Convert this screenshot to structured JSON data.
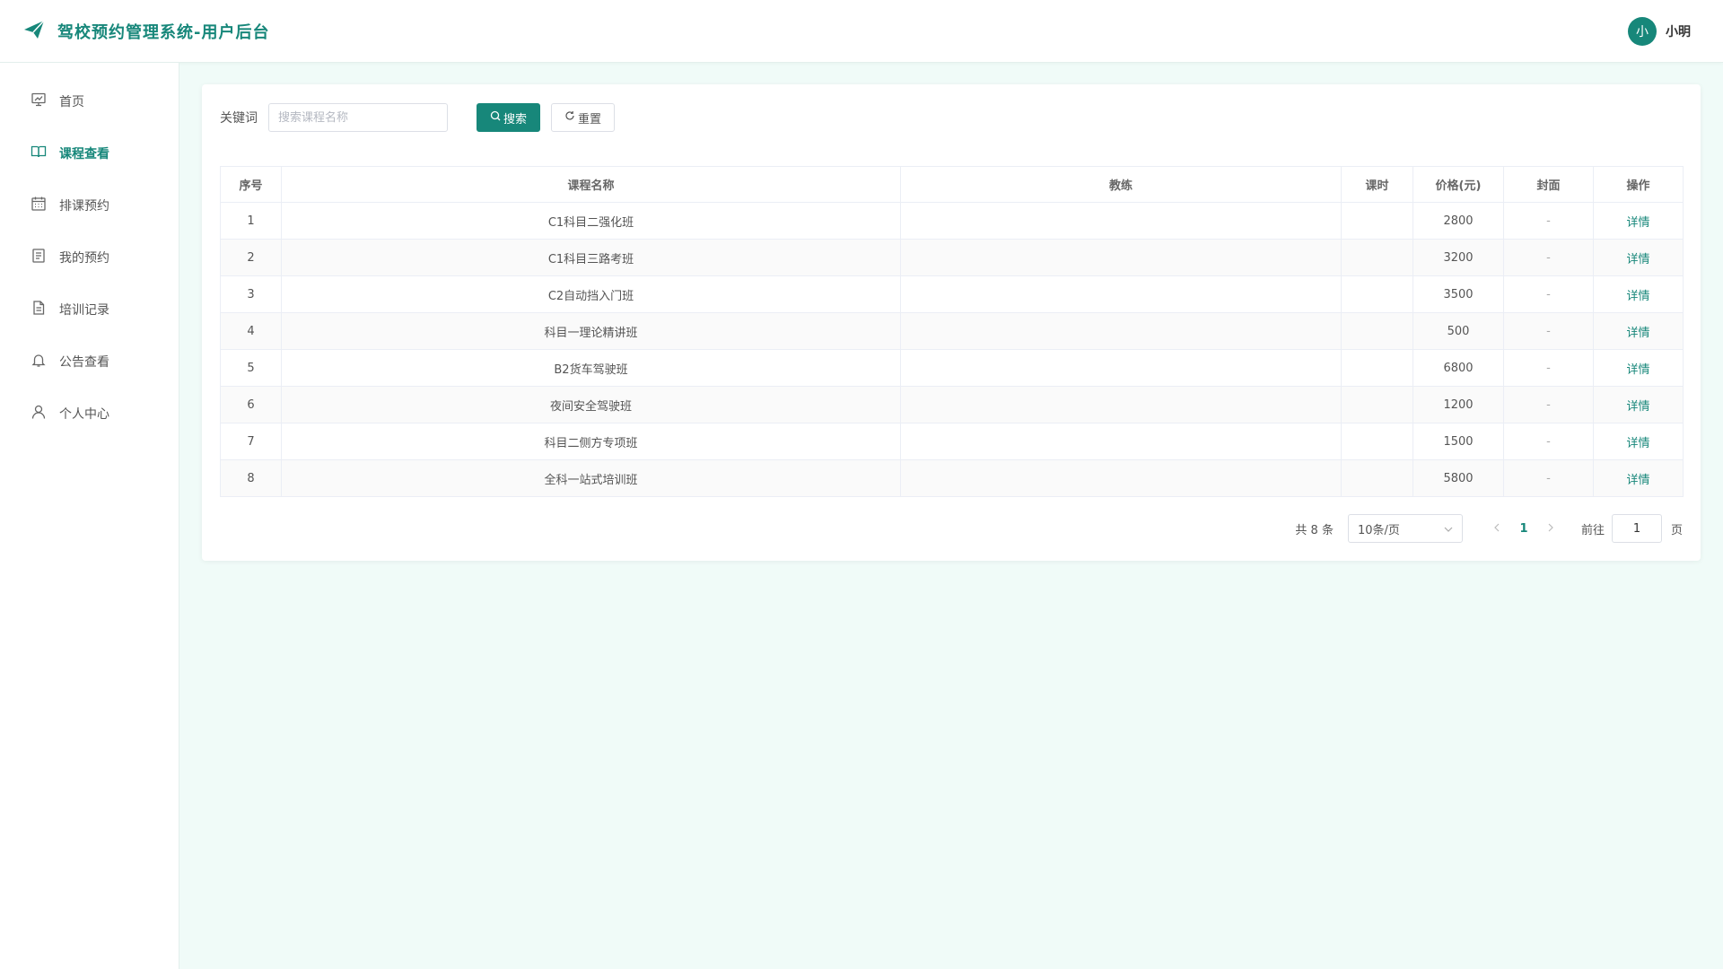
{
  "header": {
    "title": "驾校预约管理系统-用户后台",
    "avatar_text": "小",
    "username": "小明",
    "accent": "#17877a"
  },
  "sidebar": {
    "items": [
      {
        "label": "首页",
        "icon": "chart-board-icon"
      },
      {
        "label": "课程查看",
        "icon": "book-open-icon",
        "active": true
      },
      {
        "label": "排课预约",
        "icon": "calendar-icon"
      },
      {
        "label": "我的预约",
        "icon": "list-doc-icon"
      },
      {
        "label": "培训记录",
        "icon": "document-icon"
      },
      {
        "label": "公告查看",
        "icon": "bell-icon"
      },
      {
        "label": "个人中心",
        "icon": "user-icon"
      }
    ]
  },
  "search": {
    "label": "关键词",
    "placeholder": "搜索课程名称",
    "value": "",
    "search_button": "搜索",
    "reset_button": "重置"
  },
  "table": {
    "columns": [
      "序号",
      "课程名称",
      "教练",
      "课时",
      "价格(元)",
      "封面",
      "操作"
    ],
    "rows": [
      {
        "no": "1",
        "name": "C1科目二强化班",
        "coach": "",
        "hours": "",
        "price": "2800",
        "cover": "-",
        "action": "详情"
      },
      {
        "no": "2",
        "name": "C1科目三路考班",
        "coach": "",
        "hours": "",
        "price": "3200",
        "cover": "-",
        "action": "详情"
      },
      {
        "no": "3",
        "name": "C2自动挡入门班",
        "coach": "",
        "hours": "",
        "price": "3500",
        "cover": "-",
        "action": "详情"
      },
      {
        "no": "4",
        "name": "科目一理论精讲班",
        "coach": "",
        "hours": "",
        "price": "500",
        "cover": "-",
        "action": "详情"
      },
      {
        "no": "5",
        "name": "B2货车驾驶班",
        "coach": "",
        "hours": "",
        "price": "6800",
        "cover": "-",
        "action": "详情"
      },
      {
        "no": "6",
        "name": "夜间安全驾驶班",
        "coach": "",
        "hours": "",
        "price": "1200",
        "cover": "-",
        "action": "详情"
      },
      {
        "no": "7",
        "name": "科目二侧方专项班",
        "coach": "",
        "hours": "",
        "price": "1500",
        "cover": "-",
        "action": "详情"
      },
      {
        "no": "8",
        "name": "全科一站式培训班",
        "coach": "",
        "hours": "",
        "price": "5800",
        "cover": "-",
        "action": "详情"
      }
    ]
  },
  "pagination": {
    "total": "共 8 条",
    "page_size": "10条/页",
    "current_page": "1",
    "goto_label": "前往",
    "goto_value": "1",
    "page_unit": "页"
  }
}
